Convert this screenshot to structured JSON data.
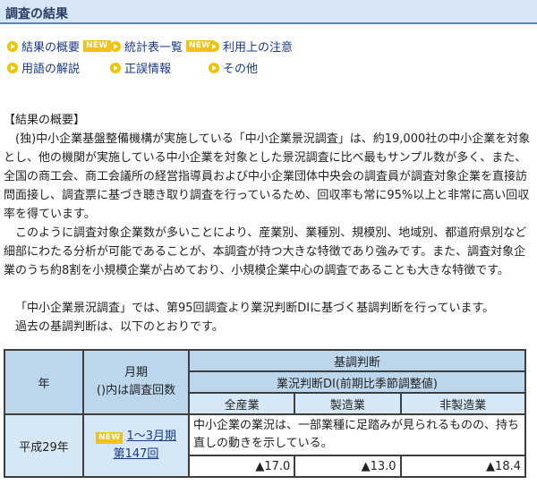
{
  "header": {
    "title": "調査の結果"
  },
  "nav": {
    "row1": [
      {
        "label": "結果の概要",
        "badge": "NEW"
      },
      {
        "label": "統計表一覧",
        "badge": "NEW"
      },
      {
        "label": "利用上の注意"
      }
    ],
    "row2": [
      {
        "label": "用語の解説"
      },
      {
        "label": "正誤情報"
      },
      {
        "label": "その他"
      }
    ]
  },
  "content": {
    "heading": "【結果の概要】",
    "para1": "(独)中小企業基盤整備機構が実施している「中小企業景況調査」は、約19,000社の中小企業を対象とし、他の機関が実施している中小企業を対象とした景況調査に比べ最もサンプル数が多く、また、全国の商工会、商工会議所の経営指導員および中小企業団体中央会の調査員が調査対象企業を直接訪問面接し、調査票に基づき聴き取り調査を行っているため、回収率も常に95%以上と非常に高い回収率を得ています。",
    "para2": "このように調査対象企業数が多いことにより、産業別、業種別、規模別、地域別、都道府県別など細部にわたる分析が可能であることが、本調査が持つ大きな特徴であり強みです。また、調査対象企業のうち約8割を小規模企業が占めており、小規模企業中心の調査であることも大きな特徴です。",
    "para3": "「中小企業景況調査」では、第95回調査より業況判断DIに基づく基調判断を行っています。",
    "para4": "過去の基調判断は、以下のとおりです。"
  },
  "table": {
    "col_year": "年",
    "col_period": "月期",
    "col_period_note": "()内は調査回数",
    "col_judgment": "基調判断",
    "col_di": "業況判断DI(前期比季節調整値)",
    "col_all": "全産業",
    "col_mfg": "製造業",
    "col_nonmfg": "非製造業",
    "rows": [
      {
        "year": "平成29年",
        "badge": "NEW",
        "period": "1～3月期",
        "survey": "第147回",
        "description": "中小企業の業況は、一部業種に足踏みが見られるものの、持ち直しの動きを示している。",
        "all": "▲17.0",
        "mfg": "▲13.0",
        "nonmfg": "▲18.4"
      }
    ]
  }
}
